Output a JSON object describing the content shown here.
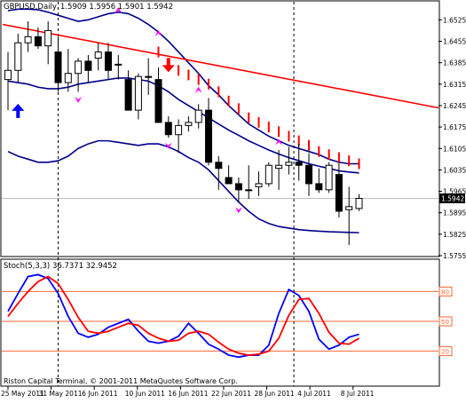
{
  "header": {
    "symbol": "GBPUSD,Daily",
    "ohlc": "1.5909 1.5956 1.5901 1.5942"
  },
  "stoch_header": "Stoch(5,3,3) 36.7371 32.9452",
  "copyright": "Riston Capital Terminal, © 2001-2011 MetaQuotes Software Corp.",
  "colors": {
    "bull_body": "#ffffff",
    "bear_body": "#000000",
    "bollinger": "#00008b",
    "trendline": "#ff0000",
    "sar": "#ff0000",
    "fractal": "#ff00ff",
    "arrow_up": "#0000ff",
    "arrow_down": "#ff0000",
    "stoch_main": "#0000ff",
    "stoch_signal": "#ff0000",
    "stoch_levels": "#ff6633"
  },
  "chart_data": [
    {
      "type": "candlestick",
      "title": "GBPUSD,Daily",
      "ylim": [
        1.5755,
        1.6555
      ],
      "y_ticks": [
        "1.6525",
        "1.6455",
        "1.6385",
        "1.6315",
        "1.6245",
        "1.6175",
        "1.6105",
        "1.6035",
        "1.5965",
        "1.5895",
        "1.5825",
        "1.5755"
      ],
      "current_price": "1.5942",
      "x_ticks": [
        "25 May 2011",
        "31 May 2011",
        "6 Jun 2011",
        "10 Jun 2011",
        "16 Jun 2011",
        "22 Jun 2011",
        "28 Jun 2011",
        "4 Jul 2011",
        "8 Jul 2011"
      ],
      "candles": [
        {
          "o": 1.633,
          "h": 1.642,
          "l": 1.623,
          "c": 1.636
        },
        {
          "o": 1.636,
          "h": 1.648,
          "l": 1.632,
          "c": 1.645
        },
        {
          "o": 1.645,
          "h": 1.652,
          "l": 1.642,
          "c": 1.647
        },
        {
          "o": 1.647,
          "h": 1.65,
          "l": 1.643,
          "c": 1.644
        },
        {
          "o": 1.644,
          "h": 1.652,
          "l": 1.638,
          "c": 1.649
        },
        {
          "o": 1.642,
          "h": 1.647,
          "l": 1.629,
          "c": 1.632
        },
        {
          "o": 1.632,
          "h": 1.643,
          "l": 1.629,
          "c": 1.635
        },
        {
          "o": 1.635,
          "h": 1.64,
          "l": 1.629,
          "c": 1.639
        },
        {
          "o": 1.639,
          "h": 1.641,
          "l": 1.632,
          "c": 1.636
        },
        {
          "o": 1.64,
          "h": 1.645,
          "l": 1.636,
          "c": 1.642
        },
        {
          "o": 1.642,
          "h": 1.645,
          "l": 1.633,
          "c": 1.636
        },
        {
          "o": 1.638,
          "h": 1.641,
          "l": 1.633,
          "c": 1.638
        },
        {
          "o": 1.633,
          "h": 1.636,
          "l": 1.624,
          "c": 1.623
        },
        {
          "o": 1.623,
          "h": 1.635,
          "l": 1.62,
          "c": 1.634
        },
        {
          "o": 1.634,
          "h": 1.64,
          "l": 1.628,
          "c": 1.634
        },
        {
          "o": 1.633,
          "h": 1.637,
          "l": 1.621,
          "c": 1.619
        },
        {
          "o": 1.619,
          "h": 1.621,
          "l": 1.614,
          "c": 1.615
        },
        {
          "o": 1.615,
          "h": 1.62,
          "l": 1.609,
          "c": 1.618
        },
        {
          "o": 1.618,
          "h": 1.621,
          "l": 1.616,
          "c": 1.619
        },
        {
          "o": 1.619,
          "h": 1.625,
          "l": 1.617,
          "c": 1.623
        },
        {
          "o": 1.623,
          "h": 1.627,
          "l": 1.605,
          "c": 1.606
        },
        {
          "o": 1.606,
          "h": 1.608,
          "l": 1.597,
          "c": 1.604
        },
        {
          "o": 1.601,
          "h": 1.605,
          "l": 1.599,
          "c": 1.599
        },
        {
          "o": 1.599,
          "h": 1.601,
          "l": 1.593,
          "c": 1.597
        },
        {
          "o": 1.597,
          "h": 1.605,
          "l": 1.594,
          "c": 1.597
        },
        {
          "o": 1.598,
          "h": 1.603,
          "l": 1.595,
          "c": 1.599
        },
        {
          "o": 1.599,
          "h": 1.606,
          "l": 1.598,
          "c": 1.605
        },
        {
          "o": 1.604,
          "h": 1.61,
          "l": 1.597,
          "c": 1.605
        },
        {
          "o": 1.605,
          "h": 1.611,
          "l": 1.602,
          "c": 1.606
        },
        {
          "o": 1.606,
          "h": 1.612,
          "l": 1.6,
          "c": 1.605
        },
        {
          "o": 1.605,
          "h": 1.609,
          "l": 1.595,
          "c": 1.599
        },
        {
          "o": 1.599,
          "h": 1.604,
          "l": 1.596,
          "c": 1.597
        },
        {
          "o": 1.597,
          "h": 1.606,
          "l": 1.596,
          "c": 1.605
        },
        {
          "o": 1.602,
          "h": 1.606,
          "l": 1.588,
          "c": 1.59
        },
        {
          "o": 1.5905,
          "h": 1.598,
          "l": 1.579,
          "c": 1.5915
        },
        {
          "o": 1.5909,
          "h": 1.5956,
          "l": 1.5901,
          "c": 1.5942
        }
      ],
      "bollinger": {
        "upper": [
          1.6555,
          1.656,
          1.656,
          1.6558,
          1.655,
          1.654,
          1.653,
          1.652,
          1.6525,
          1.6535,
          1.6545,
          1.655,
          1.6545,
          1.653,
          1.651,
          1.6485,
          1.6455,
          1.642,
          1.6385,
          1.635,
          1.631,
          1.628,
          1.6245,
          1.6215,
          1.6185,
          1.6165,
          1.6145,
          1.613,
          1.6115,
          1.6105,
          1.6095,
          1.6085,
          1.607,
          1.606,
          1.6055,
          1.6055
        ],
        "middle": [
          1.6325,
          1.632,
          1.6315,
          1.6305,
          1.63,
          1.63,
          1.6305,
          1.6315,
          1.632,
          1.6325,
          1.633,
          1.6335,
          1.6335,
          1.633,
          1.6325,
          1.631,
          1.629,
          1.6265,
          1.6245,
          1.6225,
          1.6205,
          1.6185,
          1.6165,
          1.6148,
          1.613,
          1.6115,
          1.61,
          1.6087,
          1.6075,
          1.6065,
          1.6055,
          1.6047,
          1.604,
          1.6032,
          1.6028,
          1.6025
        ],
        "lower": [
          1.6095,
          1.608,
          1.607,
          1.606,
          1.606,
          1.6065,
          1.608,
          1.6105,
          1.612,
          1.613,
          1.613,
          1.6125,
          1.612,
          1.6115,
          1.612,
          1.612,
          1.611,
          1.6095,
          1.6075,
          1.606,
          1.6035,
          1.6,
          1.5965,
          1.593,
          1.59,
          1.5875,
          1.586,
          1.585,
          1.5845,
          1.584,
          1.5837,
          1.5835,
          1.5833,
          1.5832,
          1.5831,
          1.583
        ]
      },
      "trendline": {
        "from": [
          0,
          1.651
        ],
        "to": [
          35,
          1.6255
        ]
      },
      "sar": [
        null,
        null,
        null,
        null,
        null,
        null,
        null,
        null,
        null,
        null,
        null,
        null,
        null,
        null,
        null,
        1.642,
        1.638,
        1.636,
        1.6345,
        1.633,
        1.6315,
        1.629,
        1.626,
        1.6235,
        1.6205,
        1.619,
        1.6175,
        1.616,
        1.6145,
        1.613,
        1.6115,
        1.6095,
        1.6085,
        1.6075,
        1.6065,
        1.6055
      ],
      "fractals_up": [
        {
          "i": 11,
          "y": 1.6555
        },
        {
          "i": 15,
          "y": 1.648
        },
        {
          "i": 19,
          "y": 1.6295
        },
        {
          "i": 27,
          "y": 1.6125
        }
      ],
      "fractals_down": [
        {
          "i": 7,
          "y": 1.6265
        },
        {
          "i": 16,
          "y": 1.6115
        },
        {
          "i": 23,
          "y": 1.5905
        }
      ],
      "arrows_up": [
        {
          "i": 1,
          "y": 1.6225
        }
      ],
      "arrows_down": [
        {
          "i": 16,
          "y": 1.638
        }
      ]
    },
    {
      "type": "line",
      "title": "Stoch(5,3,3) 36.7371 32.9452",
      "ylim": [
        0,
        100
      ],
      "levels": [
        20,
        50,
        80
      ],
      "level_labels": [
        "20",
        "50",
        "80"
      ],
      "series": [
        {
          "values": [
            60,
            78,
            95,
            97,
            93,
            78,
            55,
            38,
            34,
            37,
            44,
            48,
            52,
            40,
            30,
            28,
            30,
            35,
            48,
            38,
            27,
            22,
            16,
            14,
            16,
            16,
            26,
            58,
            82,
            76,
            60,
            32,
            22,
            26,
            34,
            37
          ]
        },
        {
          "values": [
            55,
            68,
            80,
            90,
            95,
            88,
            72,
            54,
            40,
            38,
            40,
            44,
            48,
            46,
            38,
            33,
            30,
            31,
            38,
            40,
            37,
            29,
            22,
            18,
            16,
            17,
            20,
            33,
            56,
            72,
            73,
            58,
            39,
            28,
            27,
            33
          ]
        }
      ]
    }
  ]
}
